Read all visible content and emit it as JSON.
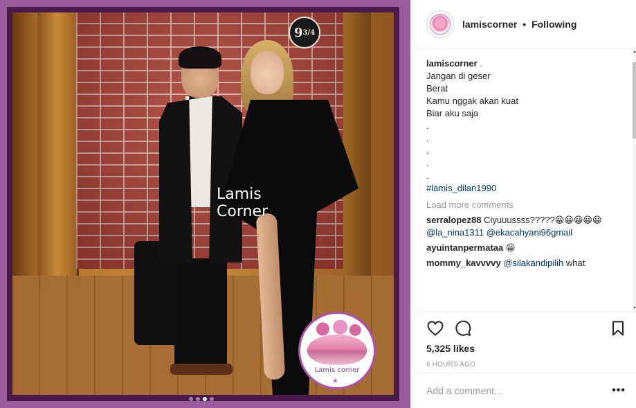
{
  "post": {
    "author": "lamiscorner",
    "separator": "•",
    "follow_status": "Following",
    "photo": {
      "sign_text": "9",
      "sign_fraction": "3/4",
      "watermark_line1": "Lamis",
      "watermark_line2": "Corner",
      "logo_text": "Lamis corner",
      "carousel_dots": 4,
      "active_dot": 3
    },
    "caption": {
      "username": "lamiscorner",
      "first_line": " .",
      "lines": [
        "Jangan di geser",
        "",
        "Berat",
        "",
        "Kamu nggak akan kuat",
        "",
        "Biar aku saja",
        ".",
        ".",
        ".",
        ".",
        "."
      ],
      "hashtag": "#lamis_dilan1990"
    },
    "load_more": "Load more comments",
    "comments": [
      {
        "user": "serralopez88",
        "text": "Ciyuuussss?????😀😀😀😀😀",
        "mentions": "@la_nina1311 @ekacahyani96gmail"
      },
      {
        "user": "ayuintanpermataa",
        "text": "😀",
        "mentions": ""
      },
      {
        "user": "mommy_kavvvvy",
        "text": "what",
        "mentions": "@silakandipilih"
      }
    ],
    "likes": "5,325 likes",
    "time": "6 HOURS AGO",
    "comment_placeholder": "Add a comment...",
    "more_glyph": "•••",
    "icons": [
      "heart-icon",
      "comment-icon",
      "bookmark-icon",
      "more-options-icon"
    ]
  }
}
